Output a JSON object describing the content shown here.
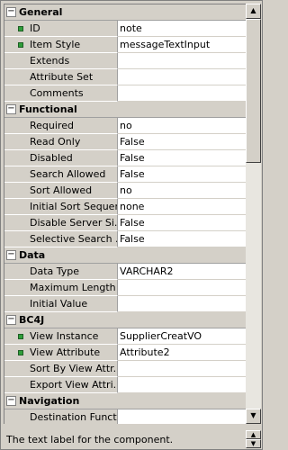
{
  "categories": [
    {
      "name": "General",
      "toggle": "−",
      "rows": [
        {
          "name": "ID",
          "value": "note",
          "required": true
        },
        {
          "name": "Item Style",
          "value": "messageTextInput",
          "required": true
        },
        {
          "name": "Extends",
          "value": ""
        },
        {
          "name": "Attribute Set",
          "value": ""
        },
        {
          "name": "Comments",
          "value": ""
        }
      ]
    },
    {
      "name": "Functional",
      "toggle": "−",
      "rows": [
        {
          "name": "Required",
          "value": "no"
        },
        {
          "name": "Read Only",
          "value": "False"
        },
        {
          "name": "Disabled",
          "value": "False"
        },
        {
          "name": "Search Allowed",
          "value": "False"
        },
        {
          "name": "Sort Allowed",
          "value": "no"
        },
        {
          "name": "Initial Sort Sequen...",
          "value": "none"
        },
        {
          "name": "Disable Server Si...",
          "value": "False"
        },
        {
          "name": "Selective Search ...",
          "value": "False"
        }
      ]
    },
    {
      "name": "Data",
      "toggle": "−",
      "rows": [
        {
          "name": "Data Type",
          "value": "VARCHAR2"
        },
        {
          "name": "Maximum Length",
          "value": ""
        },
        {
          "name": "Initial Value",
          "value": ""
        }
      ]
    },
    {
      "name": "BC4J",
      "toggle": "−",
      "rows": [
        {
          "name": "View Instance",
          "value": "SupplierCreatVO",
          "required": true
        },
        {
          "name": "View Attribute",
          "value": "Attribute2",
          "required": true
        },
        {
          "name": "Sort By View Attr...",
          "value": ""
        },
        {
          "name": "Export View Attri...",
          "value": ""
        }
      ]
    },
    {
      "name": "Navigation",
      "toggle": "−",
      "rows": [
        {
          "name": "Destination Functi...",
          "value": ""
        }
      ]
    }
  ],
  "description": "The text label for the component.",
  "icons": {
    "required_marker": "green-square-icon",
    "scroll_up": "▲",
    "scroll_down": "▼",
    "up_small": "▲",
    "down_small": "▼"
  }
}
